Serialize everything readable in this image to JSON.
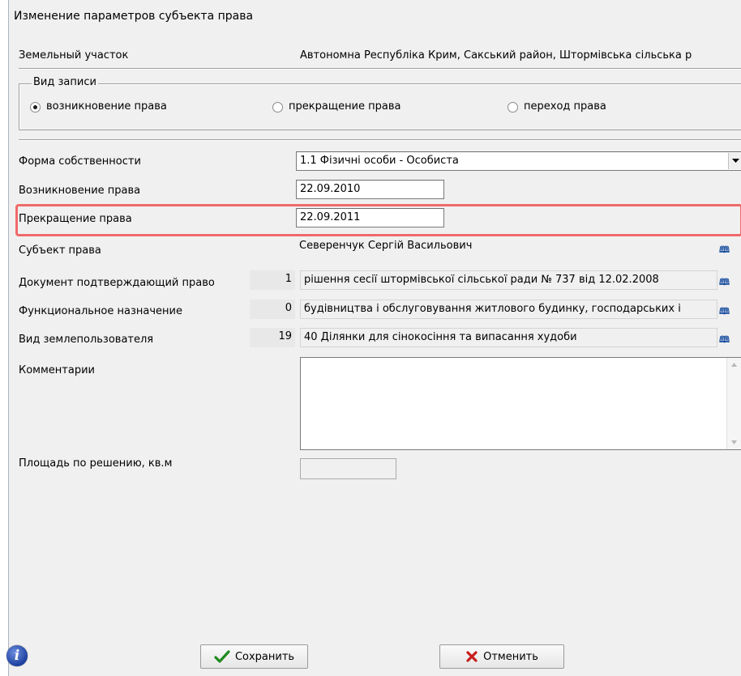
{
  "window": {
    "title": "Изменение параметров субъекта права"
  },
  "parcel": {
    "label": "Земельный участок",
    "value": "Автономна Республіка Крим, Сакський район, Штормівська сільська р"
  },
  "record_type": {
    "legend": "Вид записи",
    "options": [
      {
        "label": "возникновение права",
        "selected": true
      },
      {
        "label": "прекращение права",
        "selected": false
      },
      {
        "label": "переход права",
        "selected": false
      }
    ]
  },
  "form": {
    "ownership": {
      "label": "Форма собственности",
      "value": "1.1 Фізичні особи - Особиста"
    },
    "right_start": {
      "label": "Возникновение права",
      "value": "22.09.2010"
    },
    "right_end": {
      "label": "Прекращение права",
      "value": "22.09.2011"
    },
    "subject": {
      "label": "Субъект права",
      "value": "Северенчук Сергій Васильович"
    },
    "document": {
      "label": "Документ подтверждающий право",
      "code": "1",
      "value": "рішення сесії штормівської сільської ради № 737 від 12.02.2008"
    },
    "purpose": {
      "label": "Функциональное назначение",
      "code": "0",
      "value": "будівництва і обслуговування житлового будинку, господарських і"
    },
    "user_type": {
      "label": "Вид землепользователя",
      "code": "19",
      "value": "40 Ділянки для сінокосіння та випасання худоби"
    },
    "comments": {
      "label": "Комментарии",
      "value": ""
    },
    "area": {
      "label": "Площадь по решению, кв.м",
      "value": ""
    }
  },
  "buttons": {
    "save": "Сохранить",
    "cancel": "Отменить"
  },
  "icons": {
    "info": "info-icon",
    "lookup": "book-icon",
    "save": "checkmark-icon",
    "cancel": "cross-icon"
  },
  "colors": {
    "highlight": "#f06a6a",
    "window_bg": "#f0f0f0"
  }
}
